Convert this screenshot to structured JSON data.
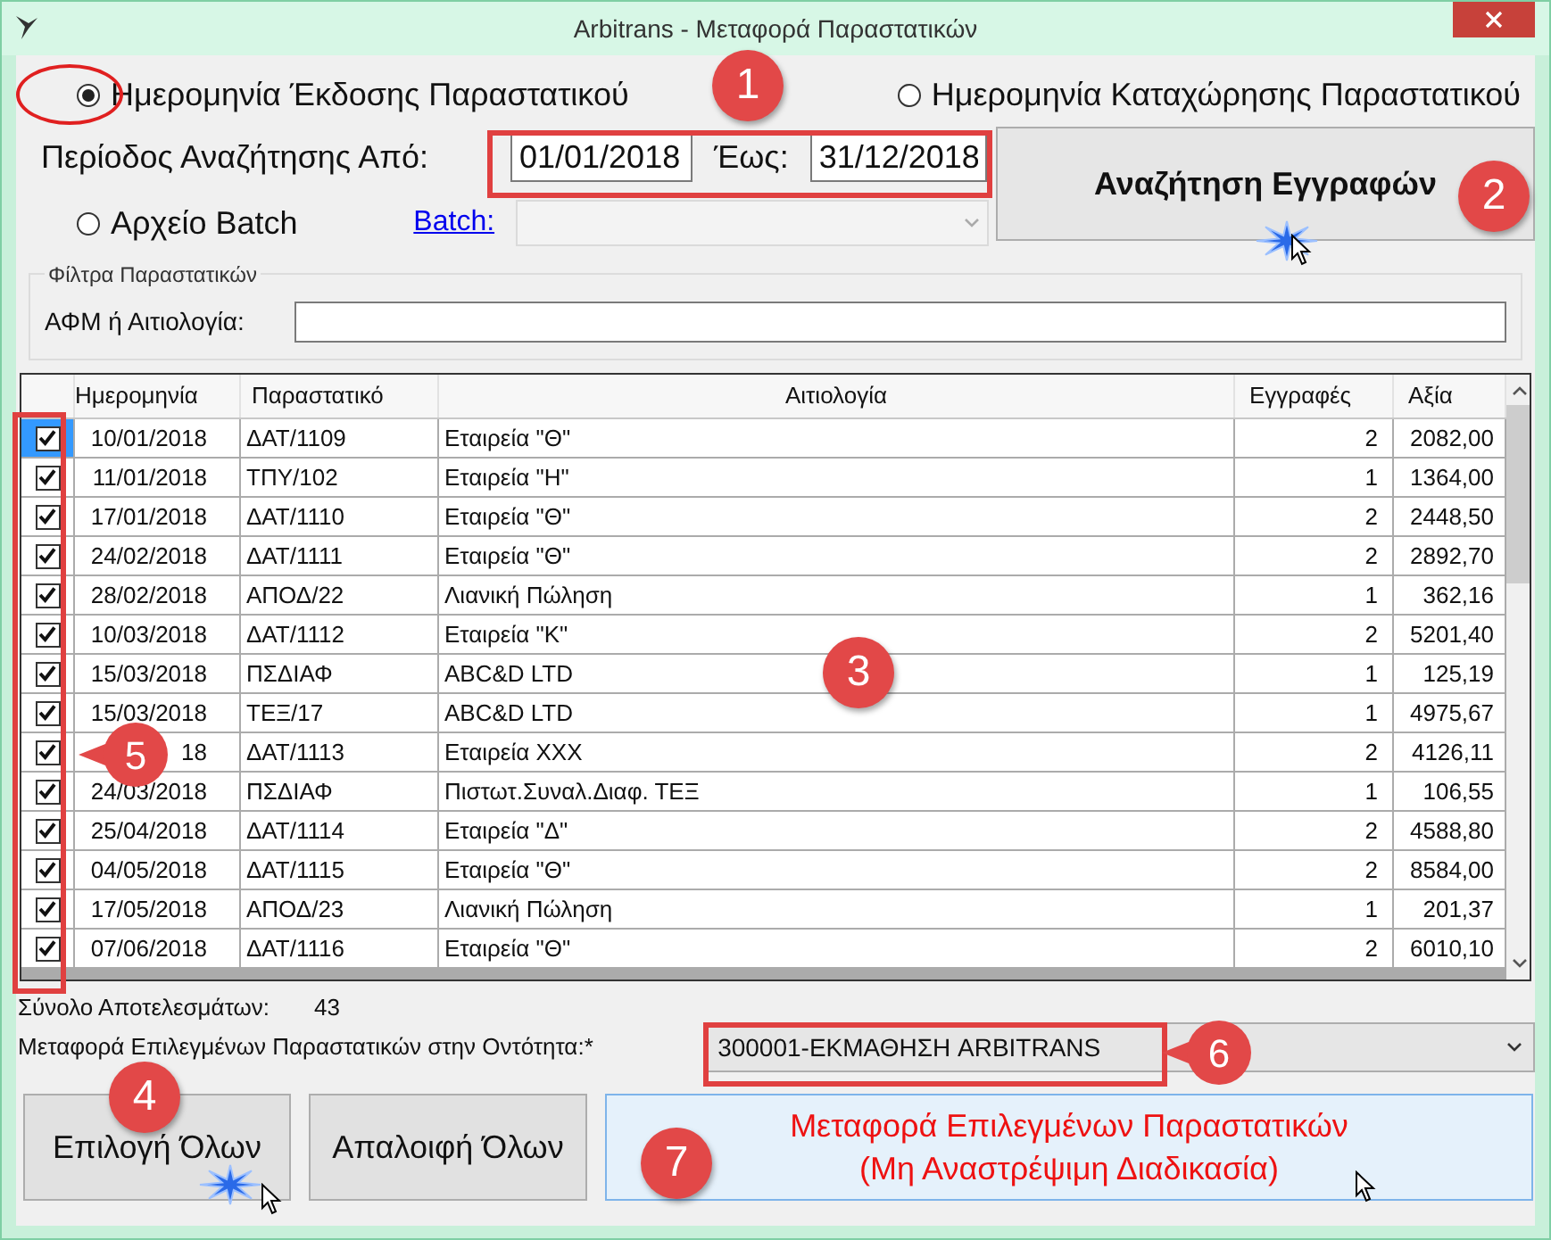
{
  "window": {
    "title": "Arbitrans - Μεταφορά Παραστατικών"
  },
  "date_mode": [
    {
      "label": "Ημερομηνία Έκδοσης Παραστατικού",
      "selected": true
    },
    {
      "label": "Ημερομηνία Καταχώρησης Παραστατικού",
      "selected": false
    }
  ],
  "period": {
    "label": "Περίοδος Αναζήτησης Από:",
    "from": "01/01/2018",
    "to_label": "Έως:",
    "to": "31/12/2018"
  },
  "search_button": "Αναζήτηση Εγγραφών",
  "batch": {
    "label": "Αρχείο Batch",
    "selected": false,
    "link": "Batch:",
    "disabled": true
  },
  "filters": {
    "title": "Φίλτρα Παραστατικών",
    "label": "ΑΦΜ ή Αιτιολογία:"
  },
  "table": {
    "columns": [
      "Ημερομηνία",
      "Παραστατικό",
      "Αιτιολογία",
      "Εγγραφές",
      "Αξία"
    ],
    "rows": [
      {
        "checked": true,
        "selected": true,
        "cells": [
          "10/01/2018",
          "ΔΑΤ/1109",
          "Εταιρεία \"Θ\"",
          "2",
          "2082,00"
        ]
      },
      {
        "checked": true,
        "selected": false,
        "cells": [
          "11/01/2018",
          "ΤΠΥ/102",
          "Εταιρεία \"Η\"",
          "1",
          "1364,00"
        ]
      },
      {
        "checked": true,
        "selected": false,
        "cells": [
          "17/01/2018",
          "ΔΑΤ/1110",
          "Εταιρεία \"Θ\"",
          "2",
          "2448,50"
        ]
      },
      {
        "checked": true,
        "selected": false,
        "cells": [
          "24/02/2018",
          "ΔΑΤ/1111",
          "Εταιρεία \"Θ\"",
          "2",
          "2892,70"
        ]
      },
      {
        "checked": true,
        "selected": false,
        "cells": [
          "28/02/2018",
          "ΑΠΟΔ/22",
          "Λιανική Πώληση",
          "1",
          "362,16"
        ]
      },
      {
        "checked": true,
        "selected": false,
        "cells": [
          "10/03/2018",
          "ΔΑΤ/1112",
          "Εταιρεία \"Κ\"",
          "2",
          "5201,40"
        ]
      },
      {
        "checked": true,
        "selected": false,
        "cells": [
          "15/03/2018",
          "ΠΣΔΙΑΦ",
          "ABC&D LTD",
          "1",
          "125,19"
        ]
      },
      {
        "checked": true,
        "selected": false,
        "cells": [
          "15/03/2018",
          "ΤΕΞ/17",
          "ABC&D LTD",
          "1",
          "4975,67"
        ]
      },
      {
        "checked": true,
        "selected": false,
        "cells": [
          "18",
          "ΔΑΤ/1113",
          "Εταιρεία ΧΧΧ",
          "2",
          "4126,11"
        ]
      },
      {
        "checked": true,
        "selected": false,
        "cells": [
          "24/03/2018",
          "ΠΣΔΙΑΦ",
          "Πιστωτ.Συναλ.Διαφ. ΤΕΞ",
          "1",
          "106,55"
        ]
      },
      {
        "checked": true,
        "selected": false,
        "cells": [
          "25/04/2018",
          "ΔΑΤ/1114",
          "Εταιρεία \"Δ\"",
          "2",
          "4588,80"
        ]
      },
      {
        "checked": true,
        "selected": false,
        "cells": [
          "04/05/2018",
          "ΔΑΤ/1115",
          "Εταιρεία \"Θ\"",
          "2",
          "8584,00"
        ]
      },
      {
        "checked": true,
        "selected": false,
        "cells": [
          "17/05/2018",
          "ΑΠΟΔ/23",
          "Λιανική Πώληση",
          "1",
          "201,37"
        ]
      },
      {
        "checked": true,
        "selected": false,
        "cells": [
          "07/06/2018",
          "ΔΑΤ/1116",
          "Εταιρεία \"Θ\"",
          "2",
          "6010,10"
        ]
      }
    ]
  },
  "total": {
    "label": "Σύνολο Αποτελεσμάτων:",
    "value": "43"
  },
  "target": {
    "label": "Μεταφορά Επιλεγμένων Παραστατικών στην Οντότητα:*",
    "value": "300001-ΕΚΜΑΘΗΣΗ ARBITRANS"
  },
  "buttons": [
    {
      "kind": "plain",
      "lines": [
        "Επιλογή Όλων"
      ]
    },
    {
      "kind": "plain",
      "lines": [
        "Απαλοιφή Όλων"
      ]
    },
    {
      "kind": "primary",
      "lines": [
        "Μεταφορά Επιλεγμένων Παραστατικών",
        "(Μη Αναστρέψιμη Διαδικασία)"
      ]
    }
  ],
  "callouts": [
    {
      "label": "1",
      "kind": "circle"
    },
    {
      "label": "2",
      "kind": "circle"
    },
    {
      "label": "3",
      "kind": "circle"
    },
    {
      "label": "4",
      "kind": "circle"
    },
    {
      "label": "5",
      "kind": "pointer"
    },
    {
      "label": "6",
      "kind": "pointer"
    },
    {
      "label": "7",
      "kind": "circle"
    }
  ]
}
